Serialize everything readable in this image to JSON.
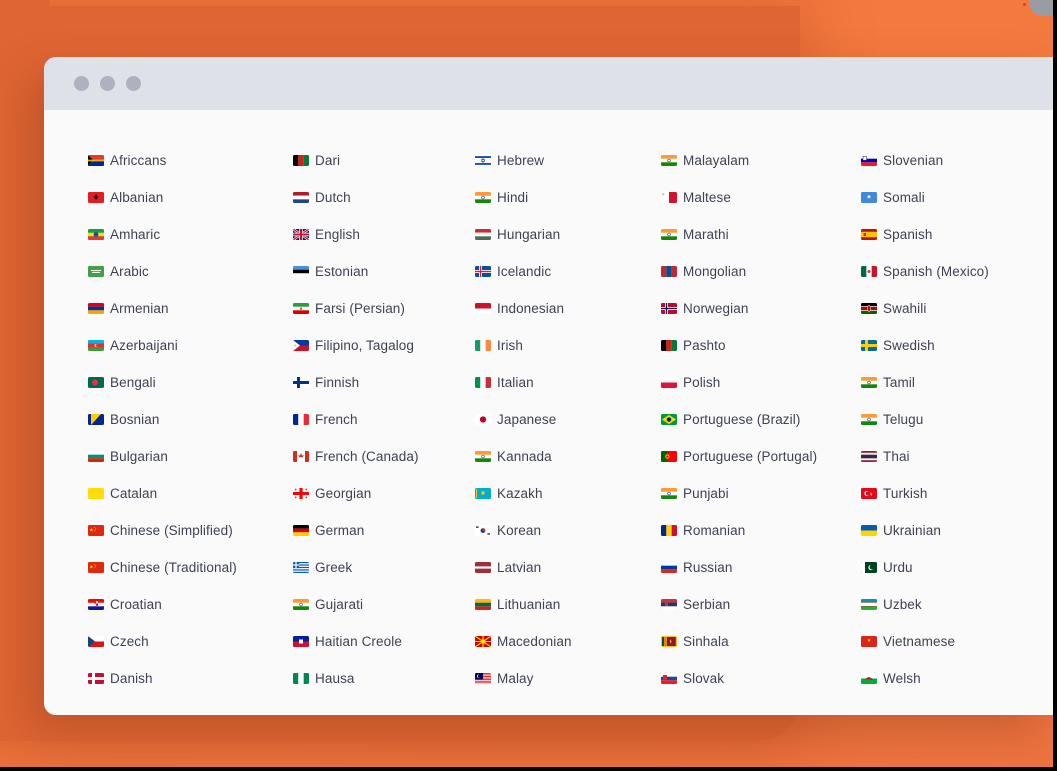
{
  "window": {
    "title_bar": {
      "dots": [
        "window-dot-1",
        "window-dot-2",
        "window-dot-3"
      ],
      "dot_color": "#aeb2c0",
      "bar_color": "#dfe1e8"
    },
    "background_color": "#fafafa"
  },
  "theme": {
    "page_background": "#f4793f",
    "page_background_shadow": "#e06534",
    "text_color": "#3e4254"
  },
  "columns": [
    {
      "index": 0,
      "items": [
        {
          "label": "Africcans",
          "flag": "za",
          "icon": "flag-south-africa-icon"
        },
        {
          "label": "Albanian",
          "flag": "al",
          "icon": "flag-albania-icon"
        },
        {
          "label": "Amharic",
          "flag": "et",
          "icon": "flag-ethiopia-icon"
        },
        {
          "label": "Arabic",
          "flag": "sa",
          "icon": "flag-saudi-arabia-icon"
        },
        {
          "label": "Armenian",
          "flag": "am",
          "icon": "flag-armenia-icon"
        },
        {
          "label": "Azerbaijani",
          "flag": "az",
          "icon": "flag-azerbaijan-icon"
        },
        {
          "label": "Bengali",
          "flag": "bd",
          "icon": "flag-bangladesh-icon"
        },
        {
          "label": "Bosnian",
          "flag": "ba",
          "icon": "flag-bosnia-icon"
        },
        {
          "label": "Bulgarian",
          "flag": "bg",
          "icon": "flag-bulgaria-icon"
        },
        {
          "label": "Catalan",
          "flag": "catalan",
          "icon": "flag-catalonia-icon"
        },
        {
          "label": "Chinese (Simplified)",
          "flag": "cn",
          "icon": "flag-china-icon"
        },
        {
          "label": "Chinese (Traditional)",
          "flag": "cn",
          "icon": "flag-china-icon"
        },
        {
          "label": "Croatian",
          "flag": "hr",
          "icon": "flag-croatia-icon"
        },
        {
          "label": "Czech",
          "flag": "cz",
          "icon": "flag-czechia-icon"
        },
        {
          "label": "Danish",
          "flag": "dk",
          "icon": "flag-denmark-icon"
        }
      ]
    },
    {
      "index": 1,
      "items": [
        {
          "label": "Dari",
          "flag": "af",
          "icon": "flag-afghanistan-icon"
        },
        {
          "label": "Dutch",
          "flag": "nl",
          "icon": "flag-netherlands-icon"
        },
        {
          "label": "English",
          "flag": "gb",
          "icon": "flag-united-kingdom-icon"
        },
        {
          "label": "Estonian",
          "flag": "ee",
          "icon": "flag-estonia-icon"
        },
        {
          "label": "Farsi (Persian)",
          "flag": "ir",
          "icon": "flag-iran-icon"
        },
        {
          "label": "Filipino, Tagalog",
          "flag": "ph",
          "icon": "flag-philippines-icon"
        },
        {
          "label": "Finnish",
          "flag": "fi",
          "icon": "flag-finland-icon"
        },
        {
          "label": "French",
          "flag": "fr",
          "icon": "flag-france-icon"
        },
        {
          "label": "French (Canada)",
          "flag": "ca",
          "icon": "flag-canada-icon"
        },
        {
          "label": "Georgian",
          "flag": "ge",
          "icon": "flag-georgia-icon"
        },
        {
          "label": "German",
          "flag": "de",
          "icon": "flag-germany-icon"
        },
        {
          "label": "Greek",
          "flag": "gr",
          "icon": "flag-greece-icon"
        },
        {
          "label": "Gujarati",
          "flag": "in",
          "icon": "flag-india-icon"
        },
        {
          "label": "Haitian Creole",
          "flag": "ht",
          "icon": "flag-haiti-icon"
        },
        {
          "label": "Hausa",
          "flag": "ng",
          "icon": "flag-nigeria-icon"
        }
      ]
    },
    {
      "index": 2,
      "items": [
        {
          "label": "Hebrew",
          "flag": "il",
          "icon": "flag-israel-icon"
        },
        {
          "label": "Hindi",
          "flag": "in",
          "icon": "flag-india-icon"
        },
        {
          "label": "Hungarian",
          "flag": "hu",
          "icon": "flag-hungary-icon"
        },
        {
          "label": "Icelandic",
          "flag": "is",
          "icon": "flag-iceland-icon"
        },
        {
          "label": "Indonesian",
          "flag": "id",
          "icon": "flag-indonesia-icon"
        },
        {
          "label": "Irish",
          "flag": "ie",
          "icon": "flag-ireland-icon"
        },
        {
          "label": "Italian",
          "flag": "it",
          "icon": "flag-italy-icon"
        },
        {
          "label": "Japanese",
          "flag": "jp",
          "icon": "flag-japan-icon"
        },
        {
          "label": "Kannada",
          "flag": "in",
          "icon": "flag-india-icon"
        },
        {
          "label": "Kazakh",
          "flag": "kz",
          "icon": "flag-kazakhstan-icon"
        },
        {
          "label": "Korean",
          "flag": "kr",
          "icon": "flag-south-korea-icon"
        },
        {
          "label": "Latvian",
          "flag": "lv",
          "icon": "flag-latvia-icon"
        },
        {
          "label": "Lithuanian",
          "flag": "lt",
          "icon": "flag-lithuania-icon"
        },
        {
          "label": "Macedonian",
          "flag": "mk",
          "icon": "flag-north-macedonia-icon"
        },
        {
          "label": "Malay",
          "flag": "my",
          "icon": "flag-malaysia-icon"
        }
      ]
    },
    {
      "index": 3,
      "items": [
        {
          "label": "Malayalam",
          "flag": "in",
          "icon": "flag-india-icon"
        },
        {
          "label": "Maltese",
          "flag": "mt",
          "icon": "flag-malta-icon"
        },
        {
          "label": "Marathi",
          "flag": "in",
          "icon": "flag-india-icon"
        },
        {
          "label": "Mongolian",
          "flag": "mn",
          "icon": "flag-mongolia-icon"
        },
        {
          "label": "Norwegian",
          "flag": "no",
          "icon": "flag-norway-icon"
        },
        {
          "label": "Pashto",
          "flag": "af",
          "icon": "flag-afghanistan-icon"
        },
        {
          "label": "Polish",
          "flag": "pl",
          "icon": "flag-poland-icon"
        },
        {
          "label": "Portuguese (Brazil)",
          "flag": "br",
          "icon": "flag-brazil-icon"
        },
        {
          "label": "Portuguese (Portugal)",
          "flag": "pt",
          "icon": "flag-portugal-icon"
        },
        {
          "label": "Punjabi",
          "flag": "in",
          "icon": "flag-india-icon"
        },
        {
          "label": "Romanian",
          "flag": "ro",
          "icon": "flag-romania-icon"
        },
        {
          "label": "Russian",
          "flag": "ru",
          "icon": "flag-russia-icon"
        },
        {
          "label": "Serbian",
          "flag": "rs",
          "icon": "flag-serbia-icon"
        },
        {
          "label": "Sinhala",
          "flag": "lk",
          "icon": "flag-sri-lanka-icon"
        },
        {
          "label": "Slovak",
          "flag": "sk",
          "icon": "flag-slovakia-icon"
        }
      ]
    },
    {
      "index": 4,
      "items": [
        {
          "label": "Slovenian",
          "flag": "si",
          "icon": "flag-slovenia-icon"
        },
        {
          "label": "Somali",
          "flag": "so",
          "icon": "flag-somalia-icon"
        },
        {
          "label": "Spanish",
          "flag": "es",
          "icon": "flag-spain-icon"
        },
        {
          "label": "Spanish (Mexico)",
          "flag": "mx",
          "icon": "flag-mexico-icon"
        },
        {
          "label": "Swahili",
          "flag": "ke",
          "icon": "flag-kenya-icon"
        },
        {
          "label": "Swedish",
          "flag": "se",
          "icon": "flag-sweden-icon"
        },
        {
          "label": "Tamil",
          "flag": "in",
          "icon": "flag-india-icon"
        },
        {
          "label": "Telugu",
          "flag": "in",
          "icon": "flag-india-icon"
        },
        {
          "label": "Thai",
          "flag": "th",
          "icon": "flag-thailand-icon"
        },
        {
          "label": "Turkish",
          "flag": "tr",
          "icon": "flag-turkey-icon"
        },
        {
          "label": "Ukrainian",
          "flag": "ua",
          "icon": "flag-ukraine-icon"
        },
        {
          "label": "Urdu",
          "flag": "pk",
          "icon": "flag-pakistan-icon"
        },
        {
          "label": "Uzbek",
          "flag": "uz",
          "icon": "flag-uzbekistan-icon"
        },
        {
          "label": "Vietnamese",
          "flag": "vn",
          "icon": "flag-vietnam-icon"
        },
        {
          "label": "Welsh",
          "flag": "wales",
          "icon": "flag-wales-icon"
        }
      ]
    }
  ]
}
